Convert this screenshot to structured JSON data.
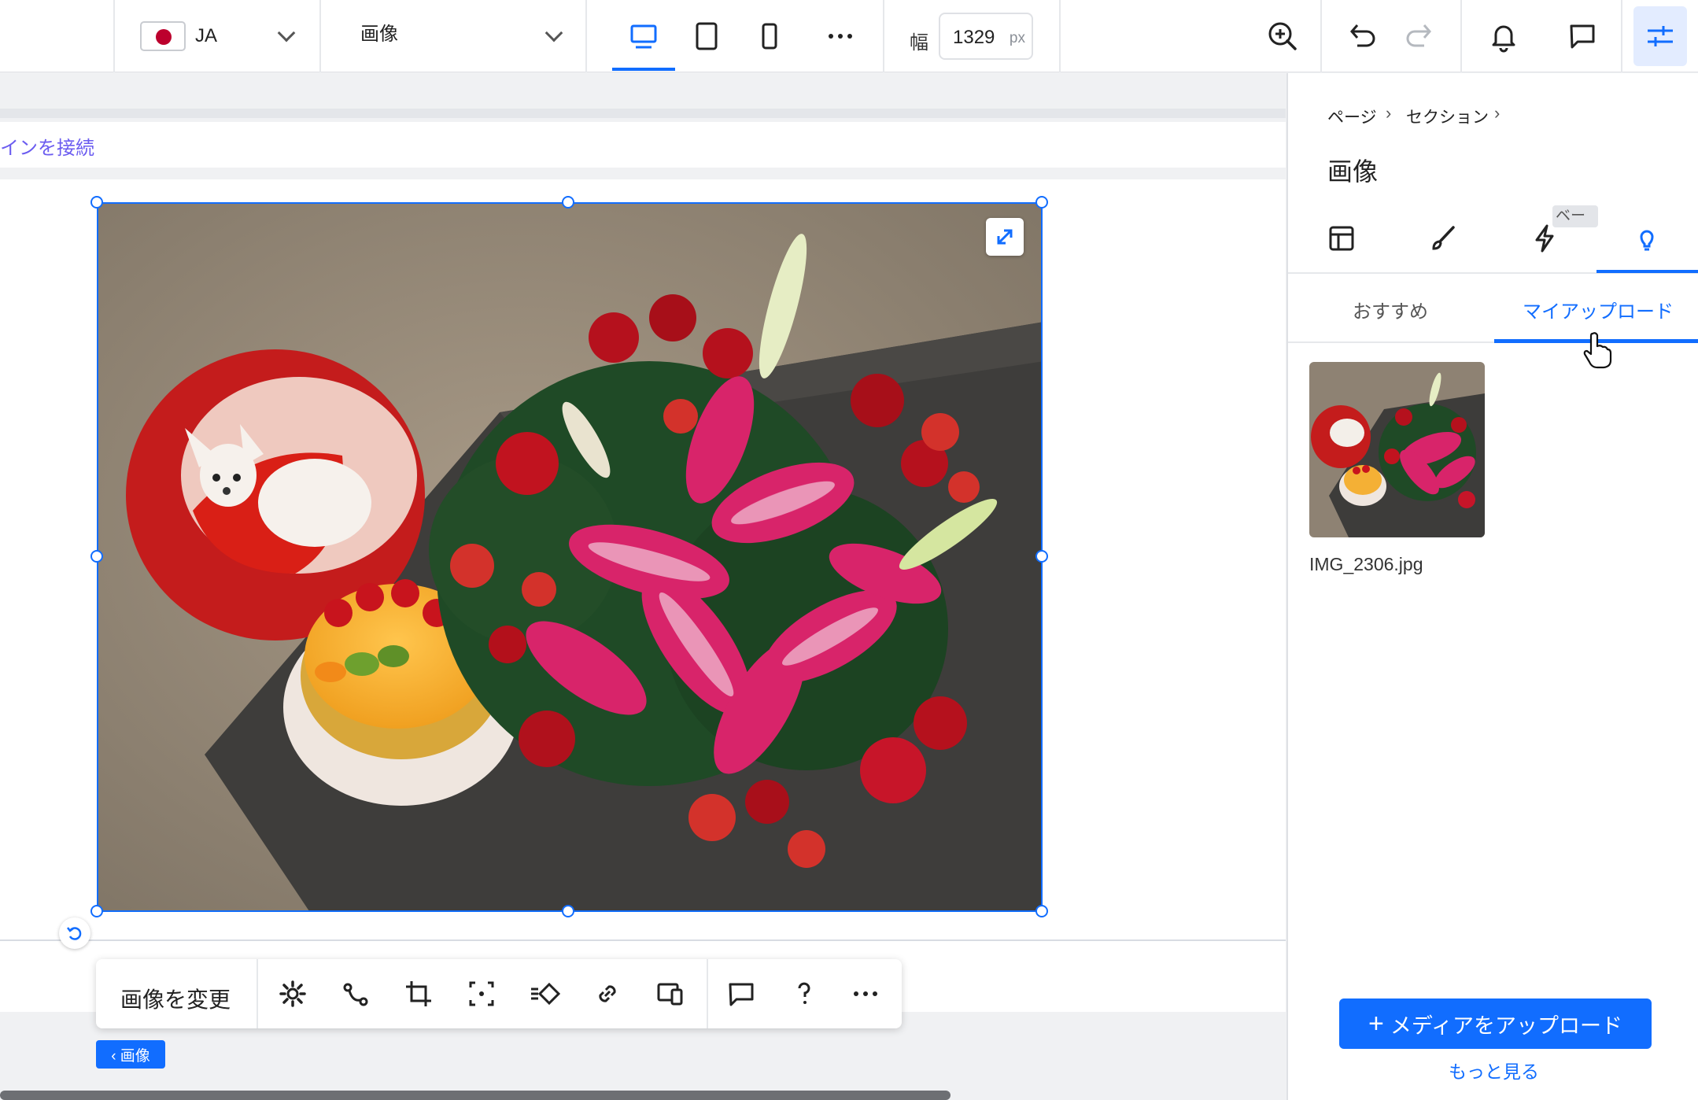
{
  "topbar": {
    "language_code": "JA",
    "page_select": "画像",
    "width_label": "幅",
    "width_value": "1329",
    "width_unit": "px"
  },
  "canvas": {
    "connect_domain_text": "メインを接続",
    "element_tag": "‹ 画像"
  },
  "floating_toolbar": {
    "change_image_label": "画像を変更"
  },
  "panel": {
    "breadcrumb": [
      "ページ",
      "セクション"
    ],
    "title": "画像",
    "beta_label": "ベータ",
    "subtabs": [
      "おすすめ",
      "マイアップロード"
    ],
    "uploaded_file": "IMG_2306.jpg",
    "upload_button": "メディアをアップロード",
    "more_link": "もっと見る"
  },
  "colors": {
    "accent": "#116dff",
    "link_purple": "#6b5cf0"
  }
}
